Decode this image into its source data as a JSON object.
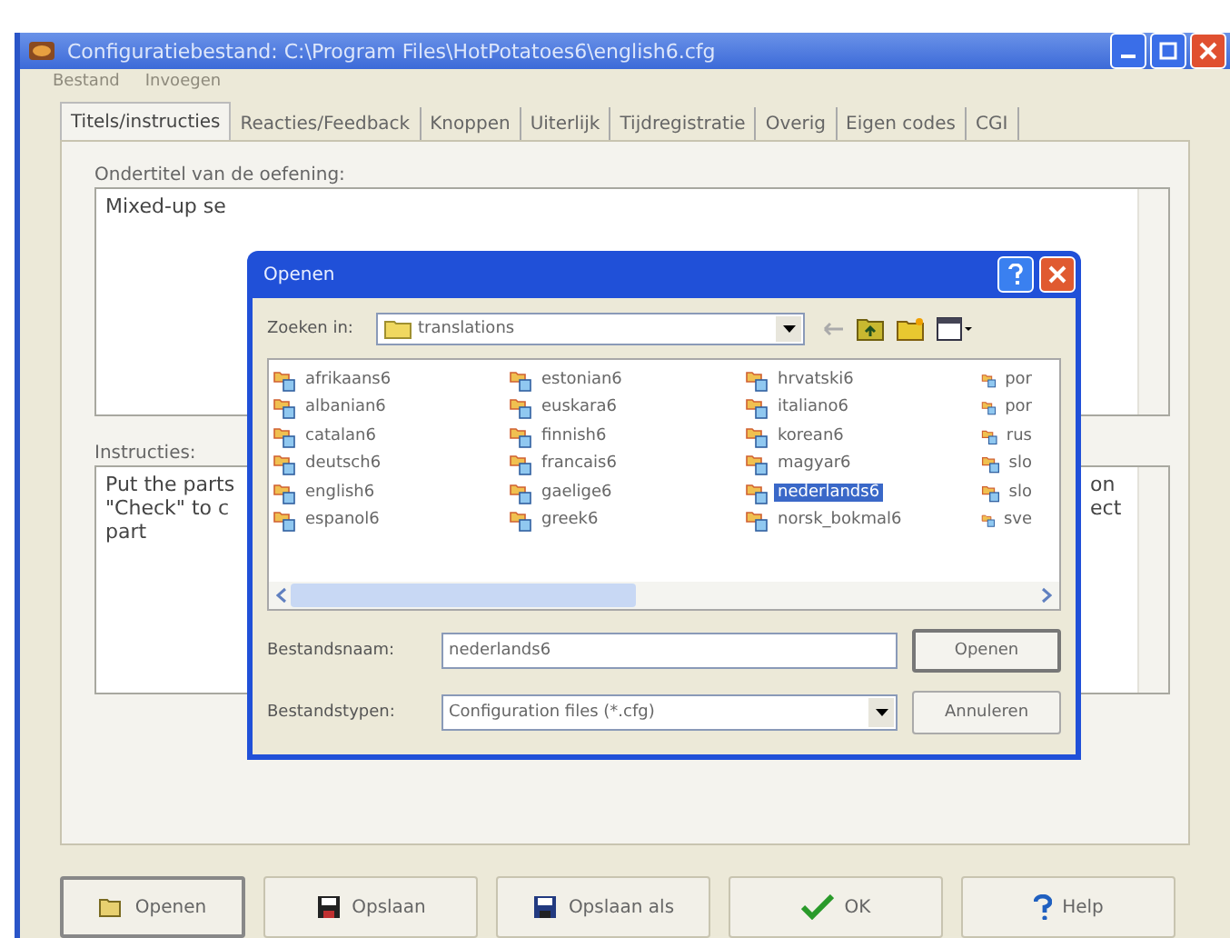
{
  "window": {
    "title": "Configuratiebestand: C:\\Program Files\\HotPotatoes6\\english6.cfg"
  },
  "menu": [
    {
      "label": "Bestand",
      "disabled": true
    },
    {
      "label": "Invoegen",
      "disabled": true
    }
  ],
  "tabs": [
    {
      "label": "Titels/instructies",
      "selected": true
    },
    {
      "label": "Reacties/Feedback",
      "selected": false
    },
    {
      "label": "Knoppen",
      "selected": false
    },
    {
      "label": "Uiterlijk",
      "selected": false
    },
    {
      "label": "Tijdregistratie",
      "selected": false
    },
    {
      "label": "Overig",
      "selected": false
    },
    {
      "label": "Eigen codes",
      "selected": false
    },
    {
      "label": "CGI",
      "selected": false
    }
  ],
  "subtitle": {
    "label": "Ondertitel van de oefening:",
    "value": "Mixed-up se"
  },
  "instructions": {
    "label": "Instructies:",
    "left_lines": [
      "Put the parts",
      "\"Check\" to c",
      "part"
    ],
    "right_lines": [
      "on",
      "ect"
    ]
  },
  "dialog": {
    "title": "Openen",
    "look_in_label": "Zoeken in:",
    "look_in": "translations",
    "files": [
      [
        {
          "name": "afrikaans6",
          "selected": false
        },
        {
          "name": "albanian6",
          "selected": false
        },
        {
          "name": "catalan6",
          "selected": false
        },
        {
          "name": "deutsch6",
          "selected": false
        },
        {
          "name": "english6",
          "selected": false
        },
        {
          "name": "espanol6",
          "selected": false
        }
      ],
      [
        {
          "name": "estonian6",
          "selected": false
        },
        {
          "name": "euskara6",
          "selected": false
        },
        {
          "name": "finnish6",
          "selected": false
        },
        {
          "name": "francais6",
          "selected": false
        },
        {
          "name": "gaelige6",
          "selected": false
        },
        {
          "name": "greek6",
          "selected": false
        }
      ],
      [
        {
          "name": "hrvatski6",
          "selected": false
        },
        {
          "name": "italiano6",
          "selected": false
        },
        {
          "name": "korean6",
          "selected": false
        },
        {
          "name": "magyar6",
          "selected": false
        },
        {
          "name": "nederlands6",
          "selected": true
        },
        {
          "name": "norsk_bokmal6",
          "selected": false
        }
      ],
      [
        {
          "name": "por",
          "selected": false
        },
        {
          "name": "por",
          "selected": false
        },
        {
          "name": "rus",
          "selected": false
        },
        {
          "name": "slo",
          "selected": false
        },
        {
          "name": "slo",
          "selected": false
        },
        {
          "name": "sve",
          "selected": false
        }
      ]
    ],
    "filename_label": "Bestandsnaam:",
    "filename": "nederlands6",
    "filetype_label": "Bestandstypen:",
    "filetype": "Configuration files (*.cfg)",
    "buttons": [
      "Openen",
      "Annuleren"
    ]
  },
  "buttons": [
    {
      "label": "Openen",
      "kind": "open"
    },
    {
      "label": "Opslaan",
      "kind": "save"
    },
    {
      "label": "Opslaan als",
      "kind": "saveas"
    },
    {
      "label": "OK",
      "kind": "ok"
    },
    {
      "label": "Help",
      "kind": "help"
    }
  ]
}
